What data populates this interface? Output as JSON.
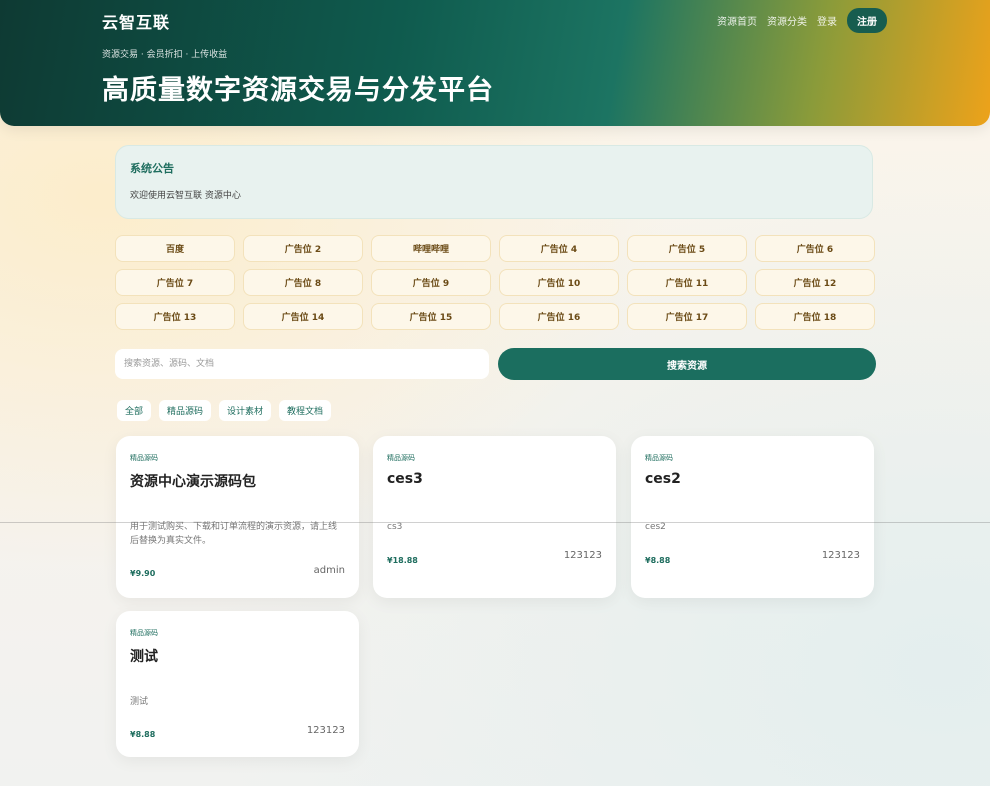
{
  "header": {
    "brand": "云智互联",
    "nav": [
      "资源首页",
      "资源分类",
      "登录"
    ],
    "register_label": "注册",
    "tagline": "资源交易 · 会员折扣 · 上传收益",
    "title": "高质量数字资源交易与分发平台"
  },
  "notice": {
    "title": "系统公告",
    "body": "欢迎使用云智互联 资源中心"
  },
  "ads": [
    "百度",
    "广告位 2",
    "哔哩哔哩",
    "广告位 4",
    "广告位 5",
    "广告位 6",
    "广告位 7",
    "广告位 8",
    "广告位 9",
    "广告位 10",
    "广告位 11",
    "广告位 12",
    "广告位 13",
    "广告位 14",
    "广告位 15",
    "广告位 16",
    "广告位 17",
    "广告位 18"
  ],
  "search": {
    "placeholder": "搜索资源、源码、文档",
    "button_label": "搜索资源"
  },
  "filters": [
    "全部",
    "精品源码",
    "设计素材",
    "教程文档"
  ],
  "cards": [
    {
      "category": "精品源码",
      "title": "资源中心演示源码包",
      "desc": "用于测试购买、下载和订单流程的演示资源，请上线后替换为真实文件。",
      "price": "¥9.90",
      "author": "admin"
    },
    {
      "category": "精品源码",
      "title": "ces3",
      "desc": "cs3",
      "price": "¥18.88",
      "author": "123123"
    },
    {
      "category": "精品源码",
      "title": "ces2",
      "desc": "ces2",
      "price": "¥8.88",
      "author": "123123"
    },
    {
      "category": "精品源码",
      "title": "测试",
      "desc": "测试",
      "price": "¥8.88",
      "author": "123123"
    }
  ]
}
